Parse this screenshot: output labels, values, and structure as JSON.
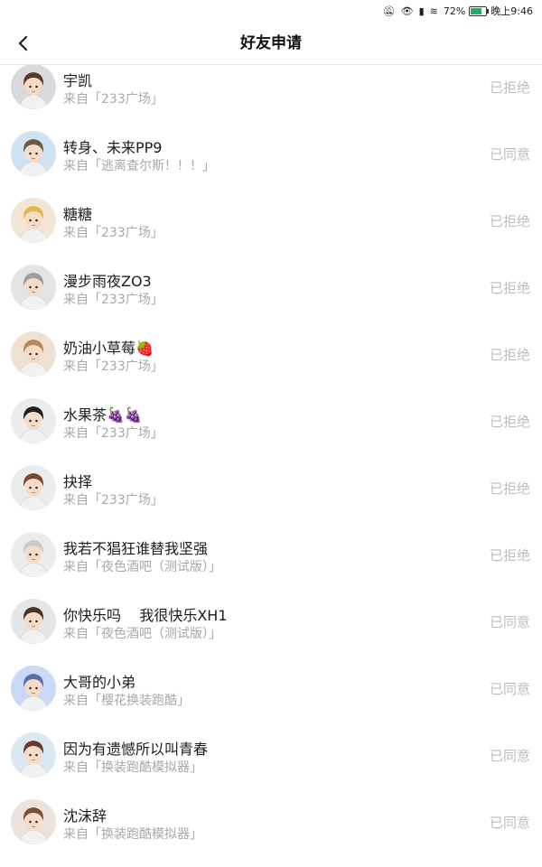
{
  "status_bar": {
    "battery": "72%",
    "time": "晚上9:46"
  },
  "header": {
    "title": "好友申请"
  },
  "requests": [
    {
      "name": "宇凯",
      "source": "来自「233广场」",
      "status": "已拒绝",
      "avatar_bg": "#d9d9de",
      "hair": "#5a3a28"
    },
    {
      "name": "转身、未来PP9",
      "source": "来自「逃离查尔斯！！！」",
      "status": "已同意",
      "avatar_bg": "#cfe3f2",
      "hair": "#6b5a40"
    },
    {
      "name": "糖糖",
      "source": "来自「233广场」",
      "status": "已拒绝",
      "avatar_bg": "#f3e6d6",
      "hair": "#e2b84a"
    },
    {
      "name": "漫步雨夜ZO3",
      "source": "来自「233广场」",
      "status": "已拒绝",
      "avatar_bg": "#e4e4e4",
      "hair": "#9c9c9c"
    },
    {
      "name": "奶油小草莓🍓",
      "source": "来自「233广场」",
      "status": "已拒绝",
      "avatar_bg": "#efe2d4",
      "hair": "#b98a55"
    },
    {
      "name": "水果茶🍇🍇",
      "source": "来自「233广场」",
      "status": "已拒绝",
      "avatar_bg": "#ececec",
      "hair": "#1f1f1f"
    },
    {
      "name": "抉择",
      "source": "来自「233广场」",
      "status": "已拒绝",
      "avatar_bg": "#ececec",
      "hair": "#7a4a30"
    },
    {
      "name": "我若不猖狂谁替我坚强",
      "source": "来自「夜色酒吧（测试版）」",
      "status": "已拒绝",
      "avatar_bg": "#ececec",
      "hair": "#c9c9c9"
    },
    {
      "name": "你快乐吗    我很快乐XH1",
      "source": "来自「夜色酒吧（测试版）」",
      "status": "已同意",
      "avatar_bg": "#e6e6e6",
      "hair": "#4a3526"
    },
    {
      "name": "大哥的小弟",
      "source": "来自「樱花换装跑酷」",
      "status": "已同意",
      "avatar_bg": "#c9d9f7",
      "hair": "#5b6ea8"
    },
    {
      "name": "因为有遗憾所以叫青春",
      "source": "来自「换装跑酷模拟器」",
      "status": "已同意",
      "avatar_bg": "#dbe8f2",
      "hair": "#6a3b2a"
    },
    {
      "name": "沈沫辞",
      "source": "来自「换装跑酷模拟器」",
      "status": "已同意",
      "avatar_bg": "#ece4dc",
      "hair": "#7a5238"
    }
  ]
}
